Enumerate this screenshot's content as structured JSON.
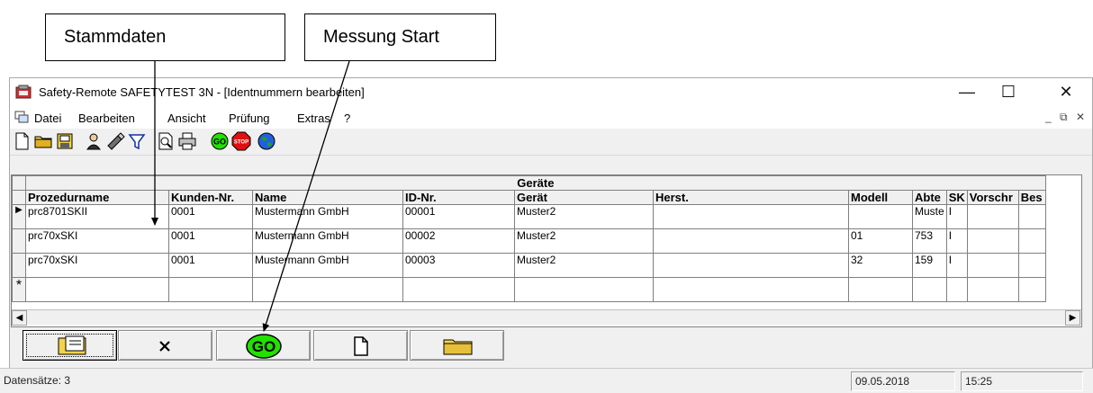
{
  "callouts": {
    "master_data": "Stammdaten",
    "measure_start": "Messung Start"
  },
  "window": {
    "title": "Safety-Remote SAFETYTEST 3N - [Identnummern bearbeiten]",
    "controls": {
      "minimize": "—",
      "maximize": "☐",
      "close": "✕"
    }
  },
  "menu": {
    "items": [
      "Datei",
      "Bearbeiten",
      "Ansicht",
      "Prüfung",
      "Extras",
      "?"
    ],
    "mdi": {
      "minimize": "_",
      "restore": "⧉",
      "close": "✕"
    }
  },
  "toolbar": {
    "icons": [
      "new-file-icon",
      "open-folder-icon",
      "save-print-icon",
      "user-icon",
      "edit-icon",
      "filter-icon",
      "print-preview-icon",
      "print-icon",
      "go-icon",
      "stop-icon",
      "globe-icon"
    ],
    "go_label": "GO",
    "stop_label": "STOP"
  },
  "grid": {
    "caption": "Geräte",
    "columns": [
      "Prozedurname",
      "Kunden-Nr.",
      "Name",
      "ID-Nr.",
      "Gerät",
      "Herst.",
      "Modell",
      "Abte",
      "SK",
      "Vorschr",
      "Bes"
    ],
    "rows": [
      [
        "prc8701SKII",
        "0001",
        "Mustermann GmbH",
        "00001",
        "Muster2",
        "",
        "",
        "Muste",
        "I",
        "",
        ""
      ],
      [
        "prc70xSKI",
        "0001",
        "Mustermann GmbH",
        "00002",
        "Muster2",
        "",
        "01",
        "753",
        "I",
        "",
        ""
      ],
      [
        "prc70xSKI",
        "0001",
        "Mustermann GmbH",
        "00003",
        "Muster2",
        "",
        "32",
        "159",
        "I",
        "",
        ""
      ]
    ],
    "new_row_marker": "*",
    "current_row_marker": "▶",
    "scroll_left": "◀",
    "scroll_right": "▶"
  },
  "buttons": {
    "go_label": "GO"
  },
  "status": {
    "records": "Datensätze: 3",
    "date": "09.05.2018",
    "time": "15:25"
  },
  "colors": {
    "go_green": "#22e000",
    "stop_red": "#e01010",
    "folder_yellow": "#f4d24a"
  }
}
